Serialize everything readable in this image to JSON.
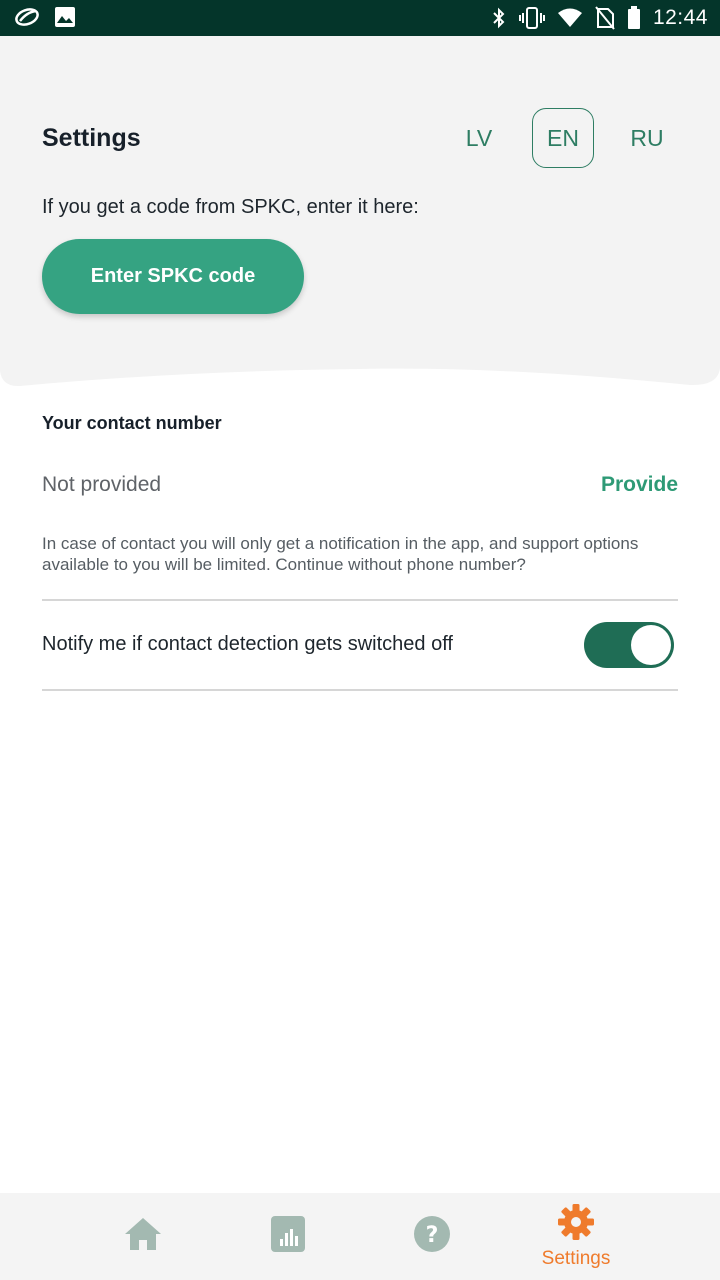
{
  "status_bar": {
    "time": "12:44",
    "left_icons": [
      "app-logo-icon",
      "image-icon"
    ],
    "right_icons": [
      "bluetooth-icon",
      "vibrate-icon",
      "wifi-icon",
      "no-sim-icon",
      "battery-icon"
    ]
  },
  "header": {
    "title": "Settings",
    "languages": [
      {
        "label": "LV",
        "selected": false
      },
      {
        "label": "EN",
        "selected": true
      },
      {
        "label": "RU",
        "selected": false
      }
    ],
    "prompt": "If you get a code from SPKC, enter it here:",
    "code_button_label": "Enter SPKC code"
  },
  "contact": {
    "title": "Your contact number",
    "value": "Not provided",
    "provide_label": "Provide",
    "info": "In case of contact you will only get a notification in the app, and support options available to you will be limited. Continue without phone number?"
  },
  "notify": {
    "label": "Notify me if contact detection gets switched off",
    "enabled": true
  },
  "bottom_nav": {
    "items": [
      {
        "icon": "home-icon",
        "label": "",
        "active": false
      },
      {
        "icon": "stats-icon",
        "label": "",
        "active": false
      },
      {
        "icon": "help-icon",
        "label": "",
        "active": false
      },
      {
        "icon": "gear-icon",
        "label": "Settings",
        "active": true
      }
    ]
  },
  "colors": {
    "status_bar": "#04352a",
    "header_bg": "#f3f3f3",
    "accent_green": "#35a382",
    "toggle_green": "#1f6d55",
    "active_orange": "#ef7b2c",
    "inactive_icon": "#a3b9b1"
  }
}
